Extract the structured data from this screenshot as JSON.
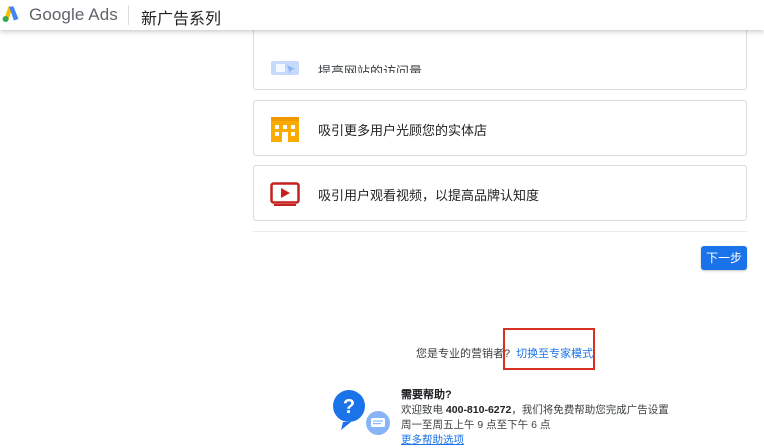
{
  "header": {
    "brand": "Google Ads",
    "title": "新广告系列"
  },
  "goals": [
    {
      "icon": "website-visits-icon",
      "label": "提高网站的访问量"
    },
    {
      "icon": "storefront-icon",
      "label": "吸引更多用户光顾您的实体店"
    },
    {
      "icon": "video-play-icon",
      "label": "吸引用户观看视频，以提高品牌认知度"
    }
  ],
  "actions": {
    "next_label": "下一步"
  },
  "expert": {
    "question": "您是专业的营销者?",
    "link_label": "切换至专家模式"
  },
  "help": {
    "title": "需要帮助?",
    "line1_prefix": "欢迎致电",
    "phone": "400-810-6272",
    "line1_suffix": "，我们将免费帮助您完成广告设置",
    "line2": "周一至周五上午 9 点至下午 6 点",
    "more_link": "更多帮助选项"
  },
  "colors": {
    "accent": "#1a73e8",
    "highlight": "#d93025",
    "store_icon": "#f9ab00",
    "video_icon": "#c5221f"
  }
}
